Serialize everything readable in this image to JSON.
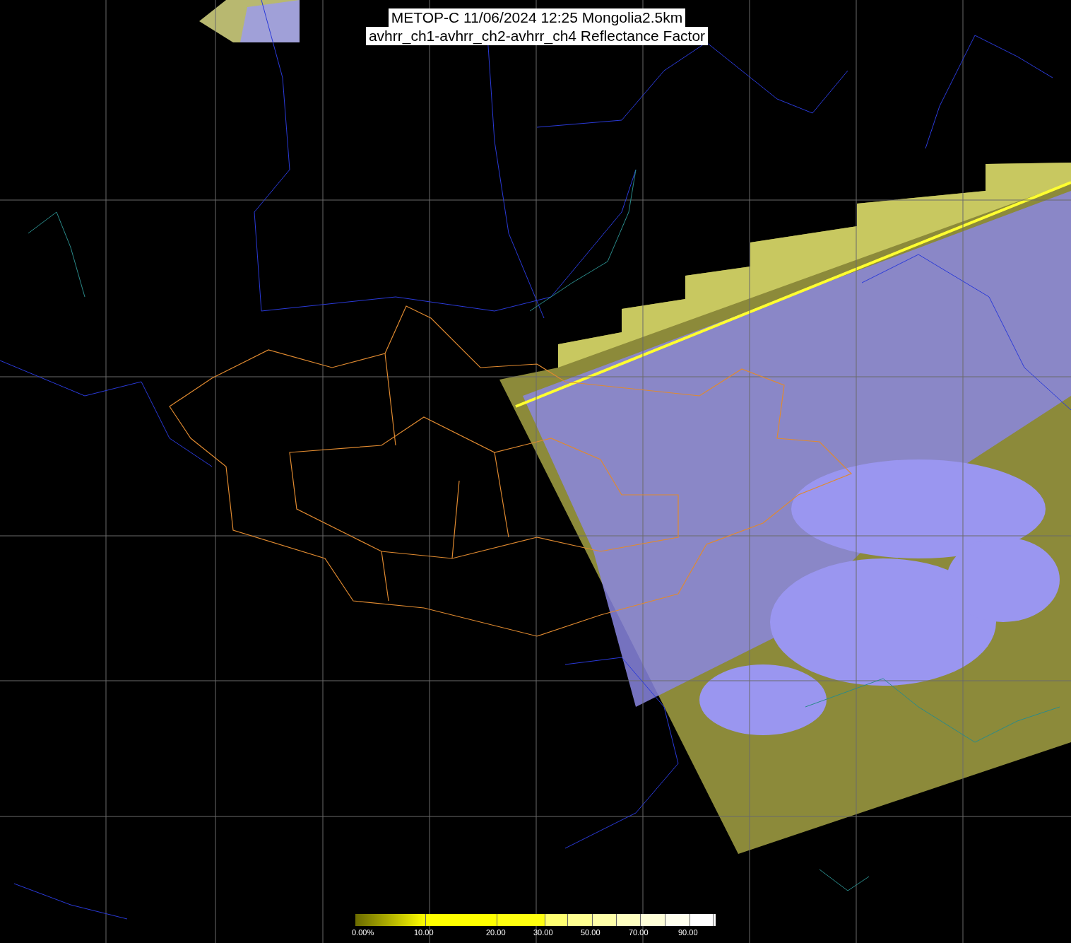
{
  "title": {
    "lines": [
      "METOP-C 11/06/2024 12:25 Mongolia2.5km",
      "avhrr_ch1-avhrr_ch2-avhrr_ch4 Reflectance Factor"
    ]
  },
  "color_scale": {
    "labels": [
      "0.00%",
      "10.00",
      "20.00",
      "30.00",
      "50.00",
      "70.00",
      "90.00"
    ]
  }
}
